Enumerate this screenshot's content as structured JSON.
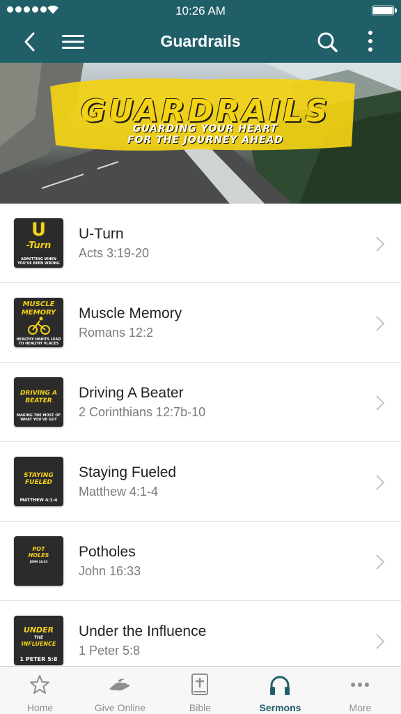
{
  "status_bar": {
    "time": "10:26 AM"
  },
  "nav": {
    "title": "Guardrails",
    "colors": {
      "bar": "#215f68",
      "text": "#ffffff"
    }
  },
  "banner": {
    "title": "GUARDRAILS",
    "subtitle_line1": "GUARDING YOUR HEART",
    "subtitle_line2": "FOR THE JOURNEY AHEAD",
    "accent": "#f4d313"
  },
  "sermons": [
    {
      "title": "U-Turn",
      "reference": "Acts 3:19-20",
      "thumb": {
        "line1": "U",
        "line2": "-Turn",
        "caption1": "ADMITTING WHEN",
        "caption2": "YOU'VE BEEN WRONG"
      }
    },
    {
      "title": "Muscle Memory",
      "reference": "Romans 12:2",
      "thumb": {
        "line1": "MUSCLE",
        "line2": "MEMORY",
        "caption1": "HEALTHY HABITS LEAD",
        "caption2": "TO HEALTHY PLACES"
      }
    },
    {
      "title": "Driving A Beater",
      "reference": "2 Corinthians 12:7b-10",
      "thumb": {
        "line1": "DRIVING A",
        "line2": "BEATER",
        "caption1": "MAKING THE MOST OF",
        "caption2": "WHAT YOU'VE GOT"
      }
    },
    {
      "title": "Staying Fueled",
      "reference": "Matthew 4:1-4",
      "thumb": {
        "line1": "STAYING",
        "line2": "FUELED",
        "caption1": "MATTHEW 4:1-4",
        "caption2": ""
      }
    },
    {
      "title": "Potholes",
      "reference": "John 16:33",
      "thumb": {
        "line1": "POT",
        "line2": "HOLES",
        "caption1": "JOHN 16:33",
        "caption2": ""
      }
    },
    {
      "title": "Under the Influence",
      "reference": "1 Peter 5:8",
      "thumb": {
        "line1": "UNDER",
        "line2": "THE",
        "line3": "INFLUENCE",
        "caption1": "1 PETER 5:8",
        "caption2": ""
      }
    }
  ],
  "tabs": [
    {
      "label": "Home",
      "icon": "star-icon",
      "active": false
    },
    {
      "label": "Give Online",
      "icon": "giving-hand-icon",
      "active": false
    },
    {
      "label": "Bible",
      "icon": "bible-icon",
      "active": false
    },
    {
      "label": "Sermons",
      "icon": "headphones-icon",
      "active": true
    },
    {
      "label": "More",
      "icon": "ellipsis-icon",
      "active": false
    }
  ],
  "colors": {
    "active_tab": "#215f68",
    "inactive_tab": "#8e8e8e",
    "accent_yellow": "#f4d313"
  }
}
